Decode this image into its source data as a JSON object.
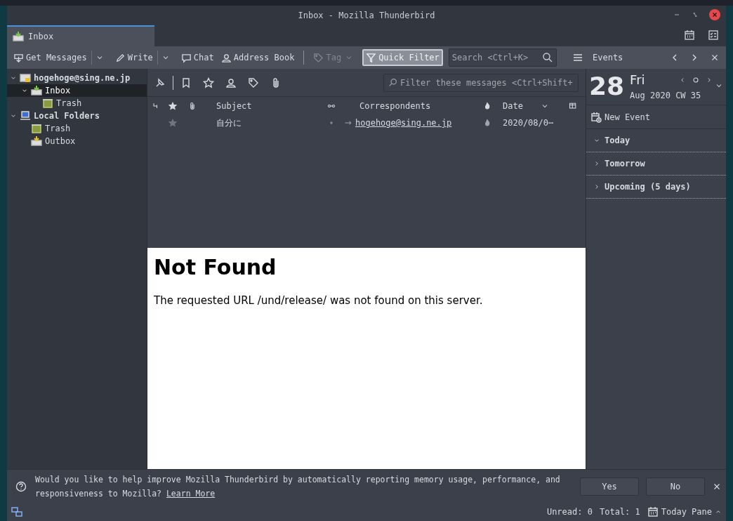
{
  "window": {
    "title": "Inbox - Mozilla Thunderbird"
  },
  "tabs": [
    {
      "label": "Inbox",
      "selected": true
    }
  ],
  "toolbar": {
    "items": [
      {
        "kind": "button",
        "label": "Get Messages",
        "dropdown": true,
        "disabled": false
      },
      {
        "kind": "button",
        "label": "Write",
        "dropdown": true,
        "disabled": false
      },
      {
        "kind": "button",
        "label": "Chat",
        "dropdown": false,
        "disabled": false
      },
      {
        "kind": "button",
        "label": "Address Book",
        "dropdown": false,
        "disabled": false
      },
      {
        "kind": "separator"
      },
      {
        "kind": "button",
        "label": "Tag",
        "dropdown": true,
        "disabled": true
      },
      {
        "kind": "toggle",
        "label": "Quick Filter",
        "on": true
      }
    ],
    "search": {
      "placeholder": "Search <Ctrl+K>"
    }
  },
  "folders": [
    {
      "label": "hogehoge@sing.ne.jp",
      "kind": "account",
      "expanded": true,
      "selected": false,
      "children": [
        {
          "label": "Inbox",
          "kind": "inbox",
          "expanded": true,
          "selected": true,
          "children": [
            {
              "label": "Trash",
              "kind": "trash",
              "selected": false
            }
          ]
        }
      ]
    },
    {
      "label": "Local Folders",
      "kind": "local",
      "expanded": true,
      "selected": false,
      "children": [
        {
          "label": "Trash",
          "kind": "trash",
          "selected": false
        },
        {
          "label": "Outbox",
          "kind": "outbox",
          "selected": false
        }
      ]
    }
  ],
  "quick_filter": {
    "placeholder": "Filter these messages <Ctrl+Shift+"
  },
  "message_list": {
    "columns": [
      {
        "kind": "thread"
      },
      {
        "kind": "star"
      },
      {
        "kind": "attachment"
      },
      {
        "kind": "text",
        "label": "Subject"
      },
      {
        "kind": "read"
      },
      {
        "kind": "text",
        "label": "Correspondents"
      },
      {
        "kind": "junk"
      },
      {
        "kind": "text",
        "label": "Date"
      },
      {
        "kind": "sort"
      },
      {
        "kind": "picker"
      }
    ],
    "rows": [
      {
        "starred": false,
        "subject": "自分に",
        "correspondent": "hogehoge@sing.ne.jp",
        "date": "2020/08/0⋯"
      }
    ]
  },
  "preview": {
    "heading": "Not Found",
    "body": "The requested URL /und/release/ was not found on this server."
  },
  "today_pane": {
    "title": "Events",
    "day": "28",
    "weekday": "Fri",
    "month_line": "Aug 2020 CW 35",
    "new_event": "New Event",
    "sections": [
      {
        "label": "Today",
        "expanded": true
      },
      {
        "label": "Tomorrow",
        "expanded": false
      },
      {
        "label": "Upcoming (5 days)",
        "expanded": false
      }
    ]
  },
  "notification": {
    "text": "Would you like to help improve Mozilla Thunderbird by automatically reporting memory usage, performance, and responsiveness to Mozilla?",
    "link": "Learn More",
    "buttons": [
      "Yes",
      "No"
    ]
  },
  "status_bar": {
    "unread": "Unread: 0",
    "total": "Total: 1",
    "today_pane": "Today Pane"
  }
}
